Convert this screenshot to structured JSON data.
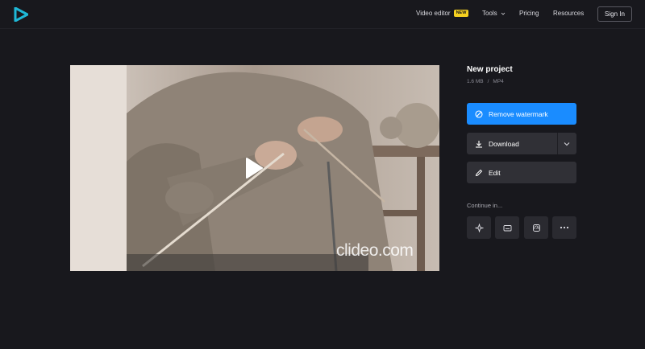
{
  "header": {
    "nav": {
      "video_editor": "Video editor",
      "new_badge": "NEW",
      "tools": "Tools",
      "pricing": "Pricing",
      "resources": "Resources"
    },
    "sign_in": "Sign In"
  },
  "video": {
    "watermark": "clideo.com"
  },
  "project": {
    "title": "New project",
    "size": "1.6 MB",
    "separator": "/",
    "format": "MP4"
  },
  "actions": {
    "remove_watermark": "Remove watermark",
    "download": "Download",
    "edit": "Edit"
  },
  "continue_label": "Continue in...",
  "continue_icons": [
    "sparkle-icon",
    "subtitles-icon",
    "speed-icon",
    "more-icon"
  ],
  "colors": {
    "background": "#18181d",
    "accent": "#1a8cff",
    "badge": "#f5d020",
    "button_dark": "#303036"
  }
}
